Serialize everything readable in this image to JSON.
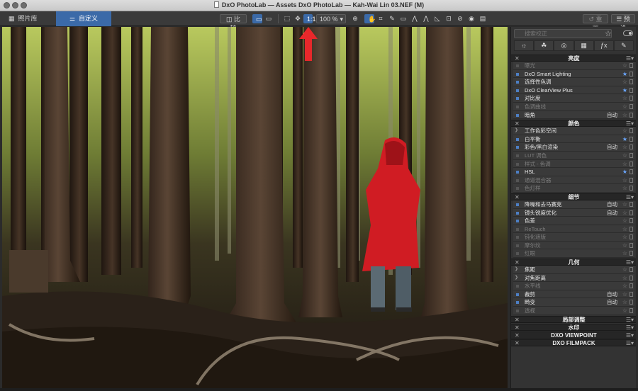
{
  "window": {
    "title": "DxO PhotoLab — Assets DxO PhotoLab — Kah-Wai Lin 03.NEF (M)"
  },
  "toolbar": {
    "tabs": [
      {
        "label": "照片库",
        "icon": "grid-icon"
      },
      {
        "label": "自定义",
        "icon": "sliders-icon"
      }
    ],
    "compare_label": "比较",
    "zoom_label": "100 %",
    "undo_label": "重置",
    "preset_label": "预设"
  },
  "panel": {
    "search_placeholder": "搜索校正",
    "tool_icons": [
      "sun-icon",
      "palette-icon",
      "aperture-icon",
      "detail-icon",
      "fx-icon",
      "eyedropper-icon"
    ],
    "sections": [
      {
        "title": "亮度",
        "rows": [
          {
            "label": "曝光",
            "dim": true,
            "on": false,
            "auto": "",
            "fav": false,
            "expand": false
          },
          {
            "label": "DxO Smart Lighting",
            "dim": false,
            "on": true,
            "auto": "",
            "fav": true,
            "expand": false
          },
          {
            "label": "选择性色调",
            "dim": false,
            "on": true,
            "auto": "",
            "fav": false,
            "expand": false
          },
          {
            "label": "DxO ClearView Plus",
            "dim": false,
            "on": true,
            "auto": "",
            "fav": true,
            "expand": false
          },
          {
            "label": "对比度",
            "dim": false,
            "on": true,
            "auto": "",
            "fav": false,
            "expand": false
          },
          {
            "label": "色调曲线",
            "dim": true,
            "on": false,
            "auto": "",
            "fav": false,
            "expand": false
          },
          {
            "label": "暗角",
            "dim": false,
            "on": true,
            "auto": "自动",
            "fav": false,
            "expand": false
          }
        ]
      },
      {
        "title": "颜色",
        "rows": [
          {
            "label": "工作色彩空间",
            "dim": false,
            "on": false,
            "auto": "",
            "fav": false,
            "expand": true
          },
          {
            "label": "白平衡",
            "dim": false,
            "on": true,
            "auto": "",
            "fav": true,
            "expand": false
          },
          {
            "label": "彩色/黑白渲染",
            "dim": false,
            "on": true,
            "auto": "自动",
            "fav": false,
            "expand": false
          },
          {
            "label": "LUT 调色",
            "dim": true,
            "on": false,
            "auto": "",
            "fav": false,
            "expand": false
          },
          {
            "label": "样式 - 色调",
            "dim": true,
            "on": false,
            "auto": "",
            "fav": false,
            "expand": false
          },
          {
            "label": "HSL",
            "dim": false,
            "on": true,
            "auto": "",
            "fav": true,
            "expand": false
          },
          {
            "label": "通道混合器",
            "dim": true,
            "on": false,
            "auto": "",
            "fav": false,
            "expand": false
          },
          {
            "label": "色灯样",
            "dim": true,
            "on": false,
            "auto": "",
            "fav": false,
            "expand": false
          }
        ]
      },
      {
        "title": "细节",
        "rows": [
          {
            "label": "降噪和去马赛克",
            "dim": false,
            "on": true,
            "auto": "自动",
            "fav": false,
            "expand": false
          },
          {
            "label": "镜头锐度优化",
            "dim": false,
            "on": true,
            "auto": "自动",
            "fav": false,
            "expand": false
          },
          {
            "label": "色差",
            "dim": false,
            "on": true,
            "auto": "",
            "fav": false,
            "expand": false
          },
          {
            "label": "ReTouch",
            "dim": true,
            "on": false,
            "auto": "",
            "fav": false,
            "expand": false
          },
          {
            "label": "钝化遮版",
            "dim": true,
            "on": false,
            "auto": "",
            "fav": false,
            "expand": false
          },
          {
            "label": "摩尔纹",
            "dim": true,
            "on": false,
            "auto": "",
            "fav": false,
            "expand": false
          },
          {
            "label": "红眼",
            "dim": true,
            "on": false,
            "auto": "",
            "fav": false,
            "expand": false
          }
        ]
      },
      {
        "title": "几何",
        "rows": [
          {
            "label": "焦距",
            "dim": false,
            "on": false,
            "auto": "",
            "fav": false,
            "expand": true
          },
          {
            "label": "对焦距离",
            "dim": false,
            "on": false,
            "auto": "",
            "fav": false,
            "expand": true
          },
          {
            "label": "水平线",
            "dim": true,
            "on": false,
            "auto": "",
            "fav": false,
            "expand": false
          },
          {
            "label": "裁剪",
            "dim": false,
            "on": true,
            "auto": "自动",
            "fav": false,
            "expand": false
          },
          {
            "label": "畸变",
            "dim": false,
            "on": true,
            "auto": "自动",
            "fav": false,
            "expand": false
          },
          {
            "label": "透视",
            "dim": true,
            "on": false,
            "auto": "",
            "fav": false,
            "expand": false
          }
        ]
      },
      {
        "title": "局部调整",
        "rows": []
      },
      {
        "title": "水印",
        "rows": []
      },
      {
        "title": "DXO VIEWPOINT",
        "rows": []
      },
      {
        "title": "DXO FILMPACK",
        "rows": []
      }
    ]
  },
  "colors": {
    "accent": "#3b6aa8",
    "arrow": "#e8282b",
    "coat": "#d01c23"
  }
}
